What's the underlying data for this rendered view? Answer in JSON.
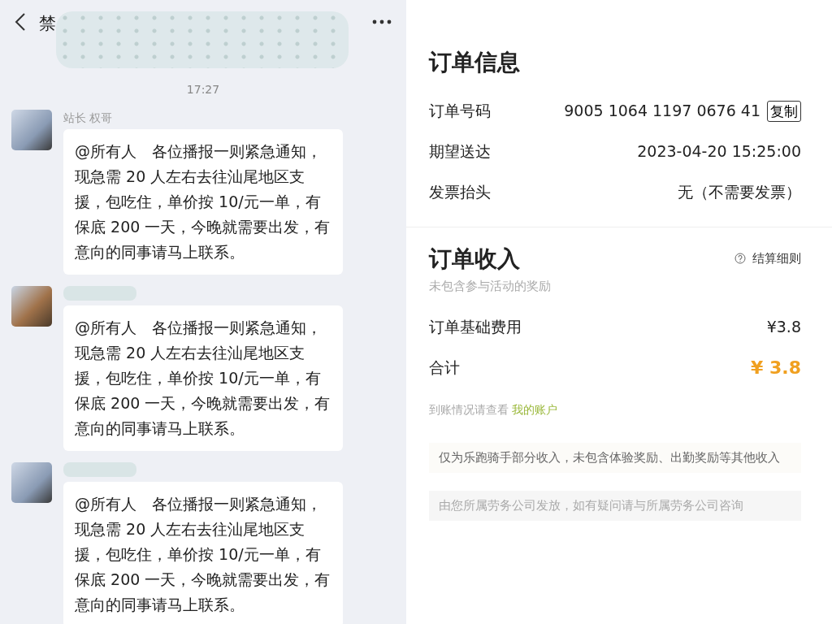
{
  "chat": {
    "title": "禁",
    "time": "17:27",
    "messages": [
      {
        "sender": "站长 权哥",
        "text": "@所有人　各位播报一则紧急通知，现急需 20 人左右去往汕尾地区支援，包吃住，单价按 10/元一单，有保底 200 一天，今晚就需要出发，有意向的同事请马上联系。"
      },
      {
        "text": "@所有人　各位播报一则紧急通知，现急需 20 人左右去往汕尾地区支援，包吃住，单价按 10/元一单，有保底 200 一天，今晚就需要出发，有意向的同事请马上联系。"
      },
      {
        "text": "@所有人　各位播报一则紧急通知，现急需 20 人左右去往汕尾地区支援，包吃住，单价按 10/元一单，有保底 200 一天，今晚就需要出发，有意向的同事请马上联系。"
      }
    ]
  },
  "order_info": {
    "title": "订单信息",
    "rows": [
      {
        "label": "订单号码",
        "value": "9005 1064 1197 0676 41",
        "action": "复制"
      },
      {
        "label": "期望送达",
        "value": "2023-04-20 15:25:00"
      },
      {
        "label": "发票抬头",
        "value": "无（不需要发票）"
      }
    ]
  },
  "order_income": {
    "title": "订单收入",
    "rules_link": "结算细则",
    "subtitle": "未包含参与活动的奖励",
    "rows": [
      {
        "label": "订单基础费用",
        "value": "¥3.8",
        "kind": "plain"
      },
      {
        "label": "合计",
        "value": "¥ 3.8",
        "kind": "total"
      }
    ],
    "account_prefix": "到账情况请查看",
    "account_link": "我的账户",
    "notes": [
      "仅为乐跑骑手部分收入，未包含体验奖励、出勤奖励等其他收入",
      "由您所属劳务公司发放，如有疑问请与所属劳务公司咨询"
    ]
  }
}
